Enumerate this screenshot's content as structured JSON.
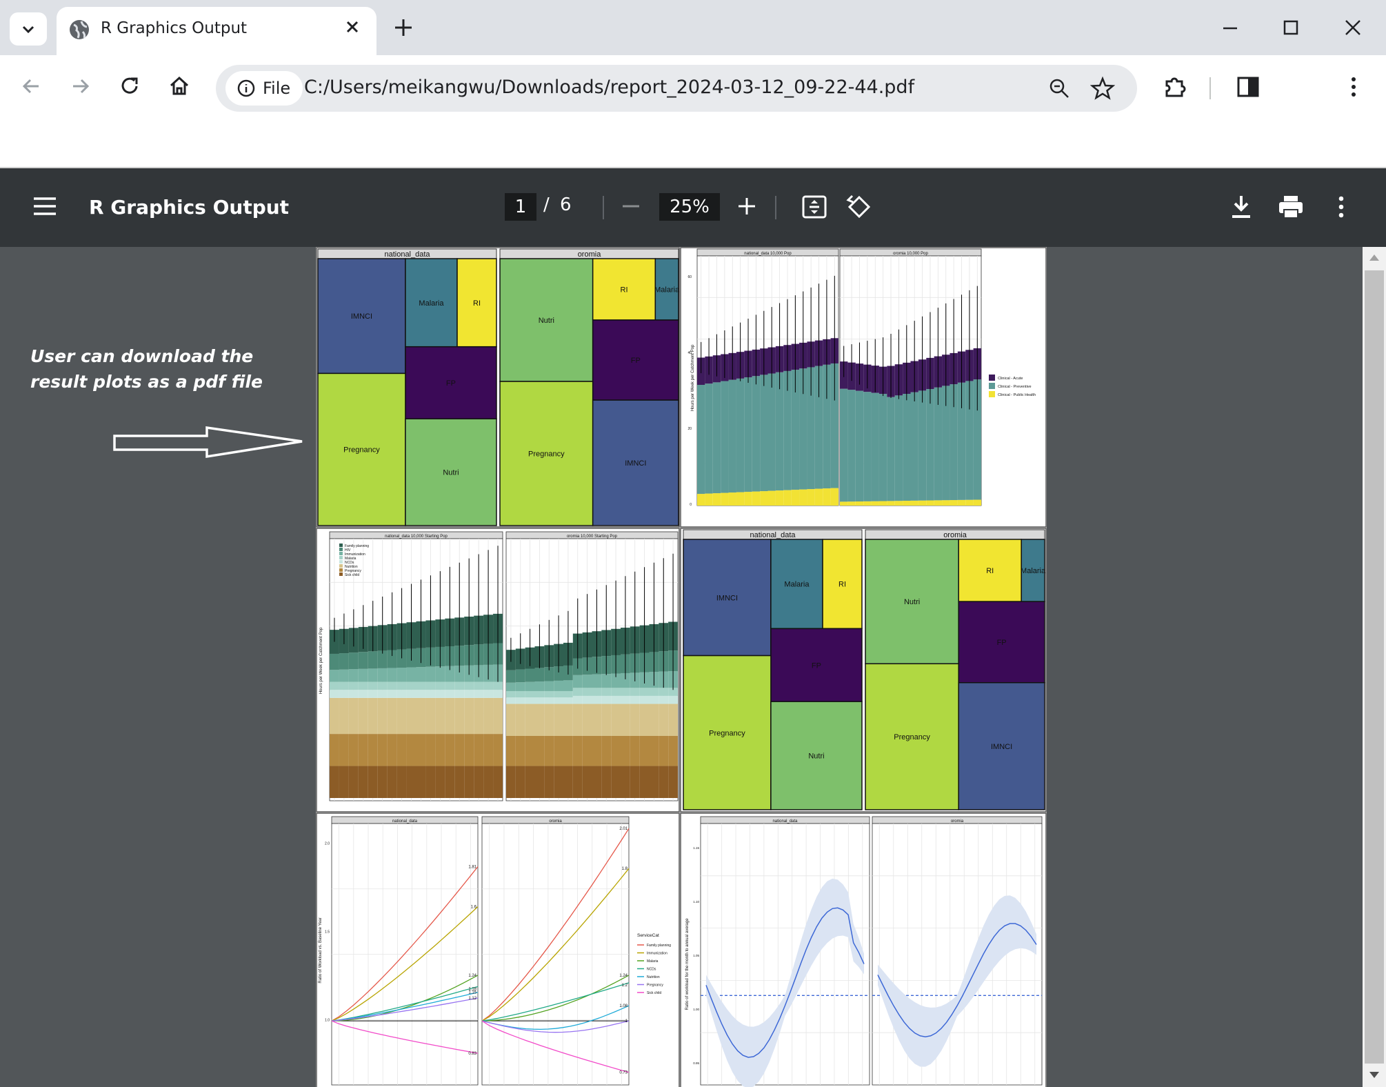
{
  "tab": {
    "title": "R Graphics Output"
  },
  "address": {
    "chip": "File",
    "url": "C:/Users/meikangwu/Downloads/report_2024-03-12_09-22-44.pdf"
  },
  "viewer": {
    "title": "R Graphics Output",
    "page": "1",
    "sep": "/",
    "total": "6",
    "zoom": "25%"
  },
  "annotation": {
    "line1": "User can download the",
    "line2": "result plots as a pdf file"
  },
  "colors": {
    "imnci": "#44598f",
    "malaria": "#3e7a8c",
    "ri": "#f1e531",
    "fp": "#3b0a57",
    "pregnancy": "#b0d842",
    "nutri": "#7ec06b",
    "acute": "#3e1b5c",
    "preventive": "#5d9a96",
    "public": "#f2e234",
    "blue_line": "#3d68d6"
  },
  "treemaps": [
    {
      "header": "national_data",
      "cells": [
        {
          "label": "IMNCI",
          "c": "imnci"
        },
        {
          "label": "Malaria",
          "c": "malaria"
        },
        {
          "label": "RI",
          "c": "ri"
        },
        {
          "label": "FP",
          "c": "fp"
        },
        {
          "label": "Pregnancy",
          "c": "pregnancy"
        },
        {
          "label": "Nutri",
          "c": "nutri"
        }
      ]
    },
    {
      "header": "oromia",
      "cells": [
        {
          "label": "Nutri",
          "c": "nutri"
        },
        {
          "label": "RI",
          "c": "ri"
        },
        {
          "label": "Malaria",
          "c": "malaria"
        },
        {
          "label": "FP",
          "c": "fp"
        },
        {
          "label": "Pregnancy",
          "c": "pregnancy"
        },
        {
          "label": "IMNCI",
          "c": "imnci"
        }
      ]
    }
  ],
  "barplot1": {
    "panels": [
      "national_data 10,000 Pop",
      "oromia 10,000 Pop"
    ],
    "ylabel": "Hours per Week per Catchment Pop",
    "yticks": [
      "0",
      "20",
      "40",
      "60"
    ],
    "legend": [
      "Clinical - Acute",
      "Clinical - Preventive",
      "Clinical - Public Health"
    ]
  },
  "barplot2": {
    "panels": [
      "national_data 10,000 Starting Pop",
      "oromia 10,000 Starting Pop"
    ],
    "ylabel": "Hours per Week per Catchment Pop",
    "yticks": [
      "0",
      "20",
      "40",
      "60"
    ],
    "legend": [
      "Family planning",
      "HIV",
      "Immunization",
      "Malaria",
      "NCDs",
      "Nutrition",
      "Pregnancy",
      "Sick child"
    ]
  },
  "lineplot": {
    "panels": [
      "national_data",
      "oromia"
    ],
    "ylabel": "Ratio of Workload vs. Baseline Year",
    "yticks": [
      "1.0",
      "1.5",
      "2.0"
    ],
    "legend_title": "ServiceCat",
    "legend": [
      "Family planning",
      "Immunization",
      "Malaria",
      "NCDs",
      "Nutrition",
      "Pregnancy",
      "Sick child"
    ],
    "end_labels_a": [
      "1.81",
      "1.6",
      "1.24",
      "1.18",
      "1.15",
      "1.12",
      "0.83"
    ],
    "end_labels_b": [
      "2.01",
      "1.8",
      "1.24",
      "1.2",
      "1.08",
      "1",
      "0.73"
    ]
  },
  "seasonal": {
    "panels": [
      "national_data",
      "oromia"
    ],
    "ylabel": "Ratio of workload for the month to annual average",
    "yticks": [
      "0.95",
      "1.00",
      "1.05",
      "1.10",
      "1.15"
    ]
  }
}
